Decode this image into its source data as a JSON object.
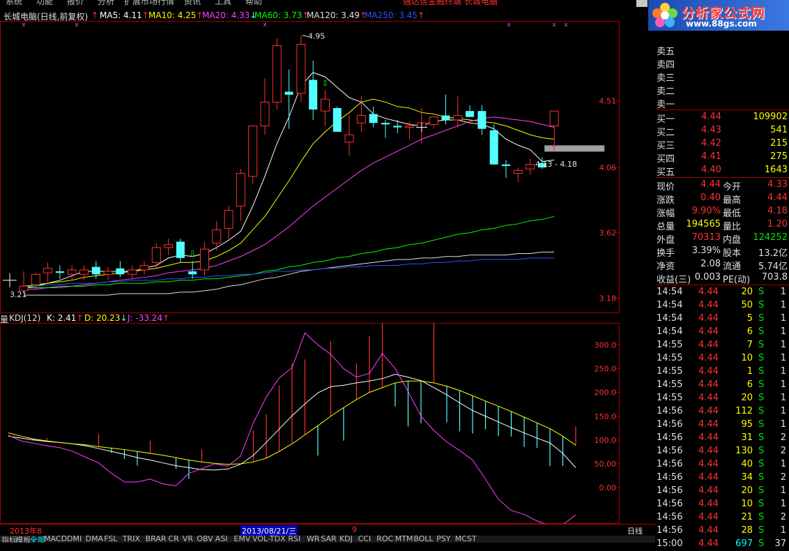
{
  "menu": {
    "items": [
      "系统",
      "功能",
      "报价",
      "分析",
      "扩展市场行情",
      "资讯",
      "工具",
      "帮助"
    ],
    "center_text": "通达信金融终端    长城电脑"
  },
  "logo": {
    "title": "分析家公式网",
    "url": "www.88gs.com"
  },
  "main_chart": {
    "stock_title": "长城电脑(日线,前复权)",
    "indicators": [
      {
        "label": "MA5: 4.11",
        "arrow": "↑",
        "color": "#ffffff"
      },
      {
        "label": "MA10: 4.25",
        "arrow": "↑",
        "color": "#ffff00"
      },
      {
        "label": "MA20: 4.33",
        "arrow": "↓",
        "color": "#ff40ff"
      },
      {
        "label": "MA60: 3.73",
        "arrow": "↑",
        "color": "#00ff00"
      },
      {
        "label": "MA120: 3.49",
        "arrow": "↑",
        "color": "#e0e0e0"
      },
      {
        "label": "MA250: 3.45",
        "arrow": "↑",
        "color": "#3050ff"
      }
    ],
    "high_marker": "4.95",
    "low_marker": "3.21",
    "range_label": "4.13 - 4.18",
    "price_ticks": [
      "4.51",
      "4.06",
      "3.62",
      "3.18"
    ]
  },
  "kdj": {
    "title": "KDJ(12)",
    "k": "K: 2.41",
    "d": "D: 20.23",
    "j": "J: -33.24",
    "ticks": [
      "300.0",
      "250.0",
      "200.0",
      "150.0",
      "100.0",
      "50.00",
      "0.00"
    ]
  },
  "axis": {
    "dates": [
      "2013年8",
      "2013/08/21/三",
      "9"
    ],
    "cycle": "日线"
  },
  "bottom_tabs": [
    "指标",
    "模板",
    "全部",
    "MACD",
    "DMI",
    "DMA",
    "FSL",
    "TRIX",
    "BRAR",
    "CR",
    "VR",
    "OBV",
    "ASI",
    "EMV",
    "VOL-TDX",
    "RSI",
    "WR",
    "SAR",
    "KDJ",
    "CCI",
    "ROC",
    "MTM",
    "BOLL",
    "PSY",
    "MCST"
  ],
  "quote": {
    "sell": [
      {
        "label": "卖五",
        "price": "",
        "vol": ""
      },
      {
        "label": "卖四",
        "price": "",
        "vol": ""
      },
      {
        "label": "卖三",
        "price": "",
        "vol": ""
      },
      {
        "label": "卖二",
        "price": "",
        "vol": ""
      },
      {
        "label": "卖一",
        "price": "",
        "vol": ""
      }
    ],
    "buy": [
      {
        "label": "买一",
        "price": "4.44",
        "vol": "109902"
      },
      {
        "label": "买二",
        "price": "4.43",
        "vol": "541"
      },
      {
        "label": "买三",
        "price": "4.42",
        "vol": "215"
      },
      {
        "label": "买四",
        "price": "4.41",
        "vol": "275"
      },
      {
        "label": "买五",
        "price": "4.40",
        "vol": "1643"
      }
    ],
    "stats": [
      {
        "l1": "现价",
        "v1": "4.44",
        "c1": "red",
        "l2": "今开",
        "v2": "4.33",
        "c2": "red"
      },
      {
        "l1": "涨跌",
        "v1": "0.40",
        "c1": "red",
        "l2": "最高",
        "v2": "4.44",
        "c2": "red"
      },
      {
        "l1": "涨幅",
        "v1": "9.90%",
        "c1": "red",
        "l2": "最低",
        "v2": "4.18",
        "c2": "red"
      },
      {
        "l1": "总量",
        "v1": "194565",
        "c1": "yel",
        "l2": "量比",
        "v2": "1.20",
        "c2": "red"
      },
      {
        "l1": "外盘",
        "v1": "70313",
        "c1": "red",
        "l2": "内盘",
        "v2": "124252",
        "c2": "grn"
      },
      {
        "l1": "换手",
        "v1": "3.39%",
        "c1": "wht",
        "l2": "股本",
        "v2": "13.2亿",
        "c2": "wht"
      },
      {
        "l1": "净资",
        "v1": "2.08",
        "c1": "wht",
        "l2": "流通",
        "v2": "5.74亿",
        "c2": "wht"
      },
      {
        "l1": "收益(三)",
        "v1": "0.003",
        "c1": "wht",
        "l2": "PE(动)",
        "v2": "703.8",
        "c2": "wht"
      }
    ],
    "ticks": [
      {
        "time": "14:54",
        "price": "4.44",
        "vol": "20",
        "bs": "S",
        "n": "1"
      },
      {
        "time": "14:54",
        "price": "4.44",
        "vol": "50",
        "bs": "S",
        "n": "1"
      },
      {
        "time": "14:54",
        "price": "4.44",
        "vol": "5",
        "bs": "S",
        "n": "1"
      },
      {
        "time": "14:54",
        "price": "4.44",
        "vol": "6",
        "bs": "S",
        "n": "1"
      },
      {
        "time": "14:55",
        "price": "4.44",
        "vol": "7",
        "bs": "S",
        "n": "1"
      },
      {
        "time": "14:55",
        "price": "4.44",
        "vol": "10",
        "bs": "S",
        "n": "1"
      },
      {
        "time": "14:55",
        "price": "4.44",
        "vol": "1",
        "bs": "S",
        "n": "1"
      },
      {
        "time": "14:55",
        "price": "4.44",
        "vol": "6",
        "bs": "S",
        "n": "1"
      },
      {
        "time": "14:55",
        "price": "4.44",
        "vol": "20",
        "bs": "S",
        "n": "1"
      },
      {
        "time": "14:56",
        "price": "4.44",
        "vol": "112",
        "bs": "S",
        "n": "1"
      },
      {
        "time": "14:56",
        "price": "4.44",
        "vol": "95",
        "bs": "S",
        "n": "1"
      },
      {
        "time": "14:56",
        "price": "4.44",
        "vol": "31",
        "bs": "S",
        "n": "2"
      },
      {
        "time": "14:56",
        "price": "4.44",
        "vol": "130",
        "bs": "S",
        "n": "2"
      },
      {
        "time": "14:56",
        "price": "4.44",
        "vol": "40",
        "bs": "S",
        "n": "1"
      },
      {
        "time": "14:56",
        "price": "4.44",
        "vol": "34",
        "bs": "S",
        "n": "2"
      },
      {
        "time": "14:56",
        "price": "4.44",
        "vol": "20",
        "bs": "S",
        "n": "1"
      },
      {
        "time": "14:56",
        "price": "4.44",
        "vol": "10",
        "bs": "S",
        "n": "1"
      },
      {
        "time": "14:56",
        "price": "4.44",
        "vol": "21",
        "bs": "S",
        "n": "2"
      },
      {
        "time": "14:56",
        "price": "4.44",
        "vol": "28",
        "bs": "S",
        "n": "1"
      },
      {
        "time": "15:00",
        "price": "4.44",
        "vol": "697",
        "bs": "S",
        "n": "37"
      }
    ]
  },
  "colors": {
    "up": "#ff3232",
    "down": "#54ffff",
    "grid": "#a00000",
    "bg": "#000000"
  },
  "chart_data": [
    {
      "type": "candlestick",
      "candles": [
        {
          "o": 3.23,
          "h": 3.36,
          "l": 3.21,
          "c": 3.26
        },
        {
          "o": 3.27,
          "h": 3.35,
          "l": 3.24,
          "c": 3.34
        },
        {
          "o": 3.35,
          "h": 3.42,
          "l": 3.28,
          "c": 3.38
        },
        {
          "o": 3.36,
          "h": 3.4,
          "l": 3.31,
          "c": 3.35
        },
        {
          "o": 3.34,
          "h": 3.4,
          "l": 3.3,
          "c": 3.37
        },
        {
          "o": 3.34,
          "h": 3.4,
          "l": 3.3,
          "c": 3.37
        },
        {
          "o": 3.39,
          "h": 3.43,
          "l": 3.31,
          "c": 3.34
        },
        {
          "o": 3.34,
          "h": 3.39,
          "l": 3.3,
          "c": 3.36
        },
        {
          "o": 3.38,
          "h": 3.43,
          "l": 3.32,
          "c": 3.34
        },
        {
          "o": 3.34,
          "h": 3.4,
          "l": 3.31,
          "c": 3.37
        },
        {
          "o": 3.37,
          "h": 3.43,
          "l": 3.34,
          "c": 3.4
        },
        {
          "o": 3.42,
          "h": 3.55,
          "l": 3.38,
          "c": 3.52
        },
        {
          "o": 3.52,
          "h": 3.58,
          "l": 3.47,
          "c": 3.54
        },
        {
          "o": 3.56,
          "h": 3.58,
          "l": 3.42,
          "c": 3.45
        },
        {
          "o": 3.36,
          "h": 3.43,
          "l": 3.31,
          "c": 3.34
        },
        {
          "o": 3.37,
          "h": 3.56,
          "l": 3.33,
          "c": 3.51
        },
        {
          "o": 3.55,
          "h": 3.7,
          "l": 3.5,
          "c": 3.64
        },
        {
          "o": 3.65,
          "h": 3.8,
          "l": 3.58,
          "c": 3.77
        },
        {
          "o": 3.8,
          "h": 4.05,
          "l": 3.7,
          "c": 4.02
        },
        {
          "o": 4.0,
          "h": 4.34,
          "l": 3.95,
          "c": 4.34
        },
        {
          "o": 4.34,
          "h": 4.66,
          "l": 4.28,
          "c": 4.5
        },
        {
          "o": 4.5,
          "h": 4.93,
          "l": 4.45,
          "c": 4.88
        },
        {
          "o": 4.57,
          "h": 4.72,
          "l": 4.32,
          "c": 4.55
        },
        {
          "o": 4.56,
          "h": 4.95,
          "l": 4.5,
          "c": 4.89
        },
        {
          "o": 4.65,
          "h": 4.78,
          "l": 4.38,
          "c": 4.45
        },
        {
          "o": 4.44,
          "h": 4.58,
          "l": 4.34,
          "c": 4.52
        },
        {
          "o": 4.46,
          "h": 4.47,
          "l": 4.3,
          "c": 4.3
        },
        {
          "o": 4.23,
          "h": 4.41,
          "l": 4.14,
          "c": 4.28
        },
        {
          "o": 4.36,
          "h": 4.54,
          "l": 4.3,
          "c": 4.41
        },
        {
          "o": 4.42,
          "h": 4.47,
          "l": 4.33,
          "c": 4.36
        },
        {
          "o": 4.36,
          "h": 4.38,
          "l": 4.26,
          "c": 4.35
        },
        {
          "o": 4.34,
          "h": 4.38,
          "l": 4.29,
          "c": 4.33
        },
        {
          "o": 4.33,
          "h": 4.37,
          "l": 4.25,
          "c": 4.34
        },
        {
          "o": 4.33,
          "h": 4.46,
          "l": 4.22,
          "c": 4.36
        },
        {
          "o": 4.35,
          "h": 4.4,
          "l": 4.32,
          "c": 4.4
        },
        {
          "o": 4.41,
          "h": 4.55,
          "l": 4.35,
          "c": 4.38
        },
        {
          "o": 4.38,
          "h": 4.54,
          "l": 4.33,
          "c": 4.41
        },
        {
          "o": 4.44,
          "h": 4.48,
          "l": 4.4,
          "c": 4.4
        },
        {
          "o": 4.44,
          "h": 4.48,
          "l": 4.28,
          "c": 4.32
        },
        {
          "o": 4.31,
          "h": 4.35,
          "l": 4.08,
          "c": 4.08
        },
        {
          "o": 4.08,
          "h": 4.11,
          "l": 3.99,
          "c": 4.07
        },
        {
          "o": 4.02,
          "h": 4.06,
          "l": 3.96,
          "c": 4.04
        },
        {
          "o": 4.05,
          "h": 4.12,
          "l": 4.01,
          "c": 4.08
        },
        {
          "o": 4.09,
          "h": 4.13,
          "l": 4.05,
          "c": 4.06
        },
        {
          "o": 4.34,
          "h": 4.44,
          "l": 4.18,
          "c": 4.44
        }
      ],
      "ma": [
        {
          "name": "MA5",
          "color": "#ffffff",
          "values": [
            3.25,
            3.26,
            3.28,
            3.3,
            3.33,
            3.36,
            3.36,
            3.36,
            3.36,
            3.36,
            3.38,
            3.4,
            3.45,
            3.47,
            3.46,
            3.48,
            3.52,
            3.57,
            3.63,
            3.8,
            4.0,
            4.22,
            4.4,
            4.61,
            4.7,
            4.67,
            4.6,
            4.53,
            4.5,
            4.42,
            4.39,
            4.37,
            4.35,
            4.34,
            4.37,
            4.38,
            4.38,
            4.36,
            4.35,
            4.32,
            4.25,
            4.21,
            4.18,
            4.1,
            4.11
          ]
        },
        {
          "name": "MA10",
          "color": "#ffff00",
          "values": [
            3.26,
            3.27,
            3.28,
            3.29,
            3.3,
            3.32,
            3.33,
            3.34,
            3.35,
            3.36,
            3.37,
            3.38,
            3.4,
            3.42,
            3.42,
            3.43,
            3.46,
            3.5,
            3.55,
            3.64,
            3.73,
            3.85,
            3.97,
            4.1,
            4.22,
            4.3,
            4.37,
            4.43,
            4.5,
            4.52,
            4.5,
            4.47,
            4.46,
            4.43,
            4.42,
            4.4,
            4.39,
            4.38,
            4.37,
            4.36,
            4.34,
            4.31,
            4.28,
            4.26,
            4.25
          ]
        },
        {
          "name": "MA20",
          "color": "#ff40ff",
          "values": [
            3.24,
            3.24,
            3.25,
            3.25,
            3.26,
            3.27,
            3.28,
            3.29,
            3.3,
            3.31,
            3.32,
            3.33,
            3.35,
            3.36,
            3.37,
            3.38,
            3.4,
            3.43,
            3.46,
            3.5,
            3.54,
            3.6,
            3.66,
            3.73,
            3.8,
            3.86,
            3.92,
            3.98,
            4.04,
            4.09,
            4.13,
            4.17,
            4.21,
            4.25,
            4.28,
            4.31,
            4.34,
            4.37,
            4.39,
            4.4,
            4.39,
            4.38,
            4.37,
            4.35,
            4.33
          ]
        },
        {
          "name": "MA60",
          "color": "#00ff00",
          "values": [
            3.25,
            3.25,
            3.25,
            3.26,
            3.26,
            3.26,
            3.27,
            3.27,
            3.28,
            3.28,
            3.28,
            3.29,
            3.29,
            3.3,
            3.3,
            3.31,
            3.31,
            3.32,
            3.33,
            3.34,
            3.36,
            3.37,
            3.39,
            3.4,
            3.42,
            3.43,
            3.45,
            3.46,
            3.48,
            3.49,
            3.51,
            3.52,
            3.54,
            3.55,
            3.57,
            3.59,
            3.61,
            3.62,
            3.64,
            3.65,
            3.67,
            3.68,
            3.7,
            3.71,
            3.73
          ]
        },
        {
          "name": "MA120",
          "color": "#e0e0e0",
          "values": [
            3.2,
            3.2,
            3.2,
            3.2,
            3.2,
            3.2,
            3.2,
            3.2,
            3.21,
            3.21,
            3.21,
            3.21,
            3.21,
            3.22,
            3.22,
            3.23,
            3.24,
            3.26,
            3.27,
            3.29,
            3.31,
            3.32,
            3.34,
            3.36,
            3.37,
            3.38,
            3.39,
            3.4,
            3.41,
            3.42,
            3.43,
            3.44,
            3.44,
            3.45,
            3.45,
            3.46,
            3.46,
            3.47,
            3.47,
            3.47,
            3.47,
            3.48,
            3.48,
            3.49,
            3.49
          ]
        },
        {
          "name": "MA250",
          "color": "#3050ff",
          "values": [
            3.26,
            3.26,
            3.27,
            3.27,
            3.28,
            3.28,
            3.28,
            3.29,
            3.29,
            3.3,
            3.3,
            3.3,
            3.31,
            3.31,
            3.32,
            3.32,
            3.33,
            3.33,
            3.34,
            3.34,
            3.35,
            3.36,
            3.36,
            3.37,
            3.37,
            3.38,
            3.38,
            3.39,
            3.39,
            3.4,
            3.4,
            3.4,
            3.41,
            3.41,
            3.42,
            3.42,
            3.43,
            3.43,
            3.44,
            3.44,
            3.44,
            3.44,
            3.45,
            3.45,
            3.45
          ]
        }
      ],
      "ylim": [
        3.13,
        5.0
      ]
    },
    {
      "type": "line",
      "series": [
        {
          "name": "K",
          "color": "#ffffff",
          "values": [
            108,
            104,
            100,
            97,
            95,
            92,
            88,
            82,
            76,
            70,
            63,
            58,
            52,
            46,
            42,
            38,
            37,
            39,
            49,
            68,
            95,
            123,
            151,
            176,
            199,
            212,
            215,
            220,
            224,
            229,
            238,
            232,
            225,
            210,
            195,
            178,
            162,
            150,
            138,
            126,
            115,
            104,
            94,
            72,
            42
          ]
        },
        {
          "name": "D",
          "color": "#ffff00",
          "values": [
            115,
            108,
            102,
            98,
            95,
            92,
            90,
            86,
            83,
            80,
            76,
            72,
            68,
            63,
            58,
            54,
            51,
            49,
            50,
            54,
            62,
            76,
            92,
            111,
            130,
            150,
            168,
            185,
            200,
            210,
            220,
            224,
            224,
            220,
            213,
            204,
            193,
            182,
            171,
            160,
            148,
            136,
            124,
            108,
            89
          ]
        },
        {
          "name": "J",
          "color": "#ff40ff",
          "values": [
            110,
            98,
            93,
            88,
            84,
            76,
            64,
            52,
            30,
            12,
            12,
            18,
            8,
            4,
            30,
            40,
            50,
            45,
            66,
            136,
            190,
            230,
            252,
            325,
            300,
            280,
            250,
            232,
            240,
            282,
            250,
            202,
            150,
            120,
            96,
            78,
            58,
            18,
            -24,
            -48,
            -56,
            -70,
            -80,
            -78,
            -57
          ]
        }
      ],
      "bars": [
        0,
        0,
        -5,
        10,
        0,
        0,
        0,
        40,
        -15,
        -30,
        -45,
        40,
        0,
        -35,
        -60,
        40,
        0,
        0,
        0,
        100,
        140,
        210,
        255,
        240,
        -95,
        240,
        -105,
        115,
        180,
        240,
        -75,
        -145,
        -135,
        235,
        -115,
        -130,
        -120,
        -90,
        -95,
        -80,
        -95,
        -80,
        -120,
        -95,
        60
      ],
      "ylim": [
        -70,
        340
      ]
    }
  ]
}
